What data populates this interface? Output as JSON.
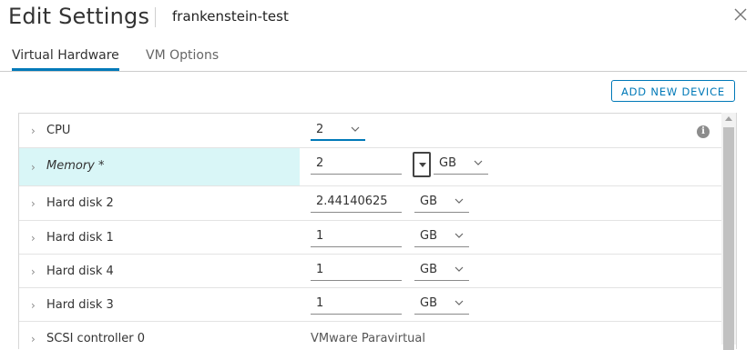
{
  "dialog": {
    "title": "Edit Settings",
    "vm_name": "frankenstein-test"
  },
  "tabs": [
    {
      "label": "Virtual Hardware",
      "active": true
    },
    {
      "label": "VM Options",
      "active": false
    }
  ],
  "toolbar": {
    "add_device_label": "ADD NEW DEVICE"
  },
  "hardware": {
    "cpu": {
      "label": "CPU",
      "value": "2"
    },
    "memory": {
      "label": "Memory *",
      "value": "2",
      "unit": "GB"
    },
    "hard_disk_2": {
      "label": "Hard disk 2",
      "value": "2.44140625",
      "unit": "GB"
    },
    "hard_disk_1": {
      "label": "Hard disk 1",
      "value": "1",
      "unit": "GB"
    },
    "hard_disk_4": {
      "label": "Hard disk 4",
      "value": "1",
      "unit": "GB"
    },
    "hard_disk_3": {
      "label": "Hard disk 3",
      "value": "1",
      "unit": "GB"
    },
    "scsi_controller_0": {
      "label": "SCSI controller 0",
      "value": "VMware Paravirtual"
    }
  },
  "colors": {
    "accent": "#0079b8",
    "highlight_row": "#d9f6f7"
  }
}
